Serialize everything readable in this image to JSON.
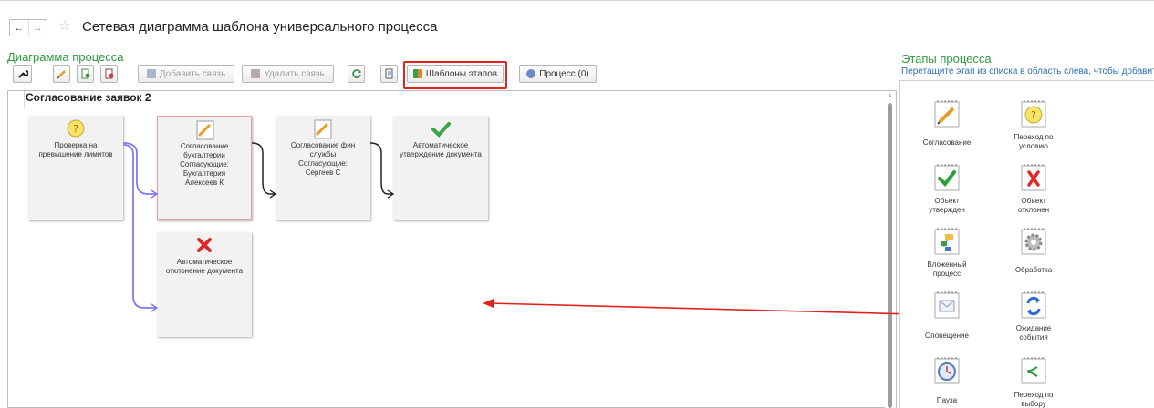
{
  "window": {
    "title": "Сетевая диаграмма шаблона универсального процесса"
  },
  "nav": {
    "back": "←",
    "forward": "→",
    "star": "☆"
  },
  "diagram_section": {
    "title": "Диаграмма процесса"
  },
  "toolbar": {
    "add_link": "Добавить связь",
    "remove_link": "Удалить связь",
    "stage_templates": "Шаблоны этапов",
    "process": "Процесс (0)"
  },
  "canvas": {
    "title": "Согласование заявок 2"
  },
  "nodes": [
    {
      "label": "Проверка на\nпревышение лимитов",
      "icon": "question-icon"
    },
    {
      "label": "Согласование\nбухгалтерии\nСогласующие:\nБухгалтерия\nАлексеев К",
      "icon": "pencil-pad-icon"
    },
    {
      "label": "Согласование фин\nслужбы\nСогласующие:\nСергеев С",
      "icon": "pencil-pad-icon"
    },
    {
      "label": "Автоматическое\nутверждение документа",
      "icon": "checkmark-icon"
    },
    {
      "label": "Автоматическое\nотклонение документа",
      "icon": "cross-icon"
    }
  ],
  "stages_section": {
    "title": "Этапы процесса",
    "hint": "Перетащите этап из списка в область слева, чтобы добавить"
  },
  "palette": [
    {
      "label": "Согласование",
      "icon": "pencil-pad-icon"
    },
    {
      "label": "Переход по\nусловию",
      "icon": "question-icon"
    },
    {
      "label": "Объект\nутвержден",
      "icon": "checkmark-icon"
    },
    {
      "label": "Объект\nотклонен",
      "icon": "cross-icon"
    },
    {
      "label": "Вложенный\nпроцесс",
      "icon": "nested-process-icon"
    },
    {
      "label": "Обработка",
      "icon": "gear-icon"
    },
    {
      "label": "Оповещение",
      "icon": "envelope-icon"
    },
    {
      "label": "Ожидание\nсобытия",
      "icon": "refresh-icon"
    },
    {
      "label": "Пауза",
      "icon": "clock-icon"
    },
    {
      "label": "Переход по\nвыбору",
      "icon": "branch-icon"
    }
  ],
  "colors": {
    "section_title": "#2e9a3e",
    "hint": "#2f6fb5",
    "highlight": "#e0231d",
    "connector_blue": "#7b7bee",
    "connector_black": "#222222"
  }
}
